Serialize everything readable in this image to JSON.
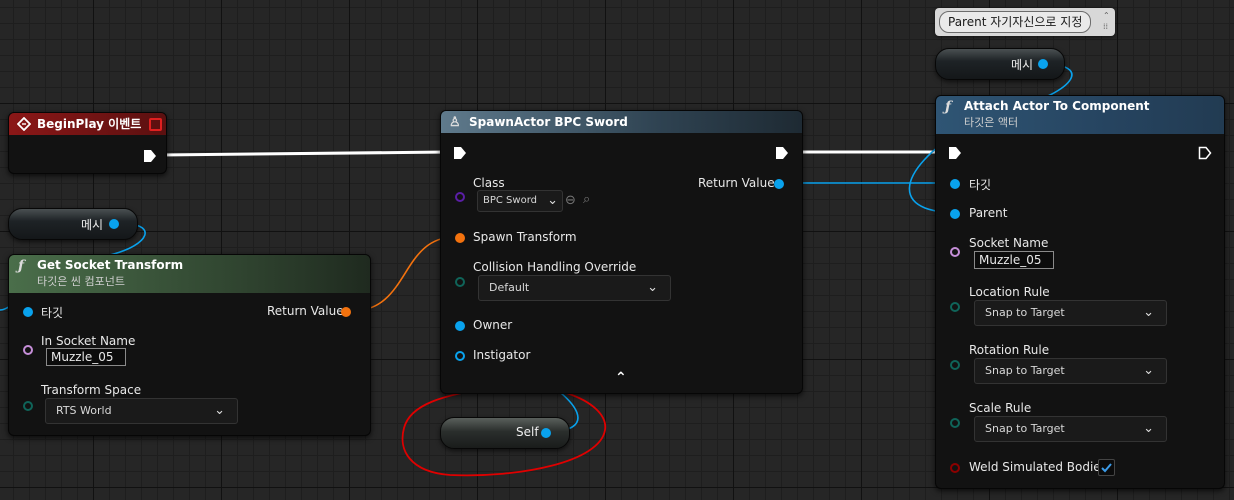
{
  "comment": {
    "text": "Parent 자기자신으로 지정"
  },
  "begin_play": {
    "title": "BeginPlay 이벤트"
  },
  "mesh_var_left": {
    "label": "메시"
  },
  "mesh_var_top": {
    "label": "메시"
  },
  "self_node": {
    "label": "Self"
  },
  "get_socket": {
    "title": "Get Socket Transform",
    "subtitle": "타깃은 씬 컴포넌트",
    "target_label": "타깃",
    "return_label": "Return Value",
    "socket_name_label": "In Socket Name",
    "socket_name_value": "Muzzle_05",
    "transform_space_label": "Transform Space",
    "transform_space_value": "RTS World"
  },
  "spawn_actor": {
    "title": "SpawnActor BPC Sword",
    "class_label": "Class",
    "class_value": "BPC Sword",
    "return_label": "Return Value",
    "spawn_transform_label": "Spawn Transform",
    "collision_label": "Collision Handling Override",
    "collision_value": "Default",
    "owner_label": "Owner",
    "instigator_label": "Instigator"
  },
  "attach": {
    "title": "Attach Actor To Component",
    "subtitle": "타깃은 액터",
    "target_label": "타깃",
    "parent_label": "Parent",
    "socket_name_label": "Socket Name",
    "socket_name_value": "Muzzle_05",
    "location_rule_label": "Location Rule",
    "location_rule_value": "Snap to Target",
    "rotation_rule_label": "Rotation Rule",
    "rotation_rule_value": "Snap to Target",
    "scale_rule_label": "Scale Rule",
    "scale_rule_value": "Snap to Target",
    "weld_label": "Weld Simulated Bodies",
    "weld_checked": true
  },
  "colors": {
    "event_header": "#8b1717",
    "function_header": "#2e4f6b",
    "pure_header": "#3d5a3d",
    "object_pin": "#09a2ed",
    "transform_pin": "#f3720e",
    "name_pin": "#c58ed8",
    "enum_pin": "#0f6459",
    "class_pin": "#5a1ea5",
    "bool_pin": "#8c0000",
    "annotation": "#e00000"
  },
  "icons": [
    "event-diamond-icon",
    "function-icon",
    "spawn-icon",
    "chevron-down-icon",
    "chevron-up-icon",
    "checkbox-check-icon",
    "exec-pin-icon",
    "delegate-square-icon"
  ]
}
